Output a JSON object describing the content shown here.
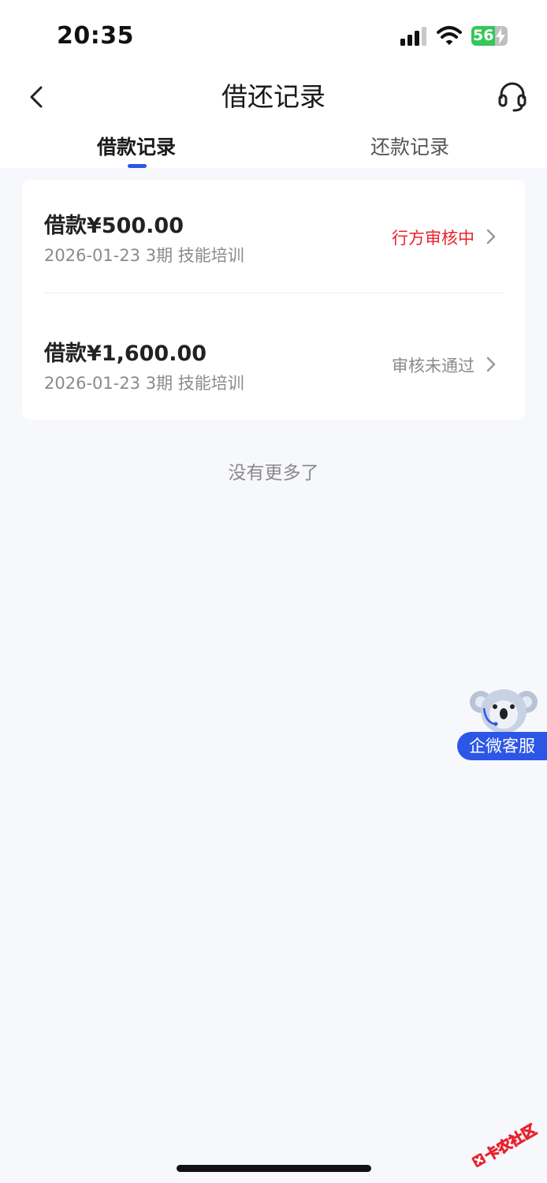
{
  "status_bar": {
    "time": "20:35",
    "battery": "56"
  },
  "nav": {
    "title": "借还记录"
  },
  "tabs": [
    {
      "label": "借款记录",
      "active": true
    },
    {
      "label": "还款记录",
      "active": false
    }
  ],
  "records": [
    {
      "amount": "借款¥500.00",
      "meta": "2026-01-23 3期  技能培训",
      "status": "行方审核中",
      "status_color": "#e8222d"
    },
    {
      "amount": "借款¥1,600.00",
      "meta": "2026-01-23 3期  技能培训",
      "status": "审核未通过",
      "status_color": "#8a8a8a"
    }
  ],
  "footer": {
    "no_more": "没有更多了"
  },
  "float_cs": {
    "label": "企微客服"
  },
  "watermark": {
    "text": "卡农社区"
  },
  "colors": {
    "accent": "#2b56e8",
    "danger": "#e8222d",
    "background": "#f7f8fc"
  },
  "icons": [
    "signal-icon",
    "wifi-icon",
    "battery-icon",
    "back-arrow-icon",
    "headset-icon",
    "chevron-right-icon",
    "koala-mascot-icon"
  ]
}
